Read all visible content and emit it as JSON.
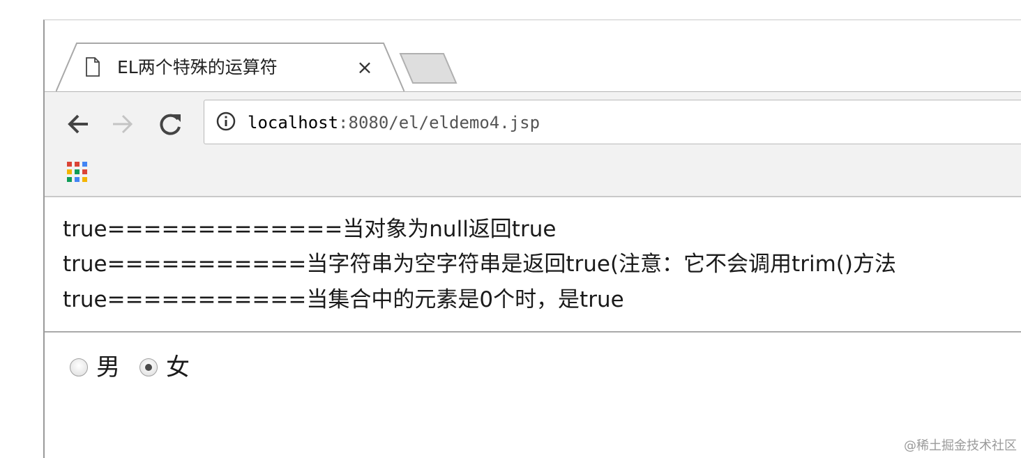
{
  "tab": {
    "title": "EL两个特殊的运算符",
    "close_label": "×"
  },
  "address": {
    "host": "localhost",
    "path": ":8080/el/eldemo4.jsp"
  },
  "icons": {
    "tab": "document-icon",
    "back": "back-arrow-icon",
    "forward": "forward-arrow-icon",
    "reload": "reload-icon",
    "info": "info-icon",
    "apps": "apps-grid-icon"
  },
  "content": {
    "lines": [
      "true=============当对象为null返回true",
      "true===========当字符串为空字符串是返回true(注意：它不会调用trim()方法",
      "true===========当集合中的元素是0个时，是true"
    ],
    "radio_options": [
      {
        "label": "男",
        "checked": false
      },
      {
        "label": "女",
        "checked": true
      }
    ]
  },
  "watermark": "@稀土掘金技术社区"
}
